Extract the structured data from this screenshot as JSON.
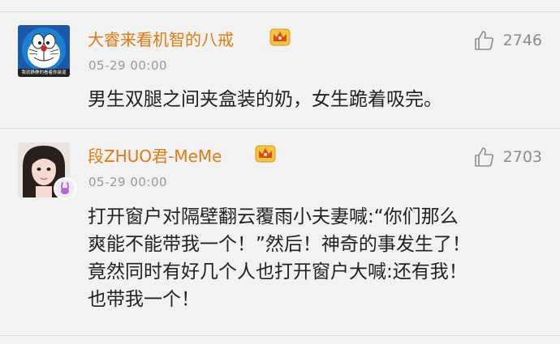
{
  "comments": [
    {
      "username": "大睿来看机智的八戒",
      "timestamp": "05-29 00:00",
      "likes": "2746",
      "text": "男生双腿之间夹盒装的奶，女生跪着吸完。",
      "avatar_caption": "我就静静的看着你装逼"
    },
    {
      "username": "段ZHUO君-MeMe",
      "timestamp": "05-29 00:00",
      "likes": "2703",
      "text": "打开窗户对隔壁翻云覆雨小夫妻喊:“你们那么爽能不能带我一个！”然后！神奇的事发生了！竟然同时有好几个人也打开窗户大喊:还有我！也带我一个！"
    }
  ],
  "colors": {
    "username": "#e07a12",
    "timestamp": "#9a9a9a",
    "text": "#222222",
    "likes": "#8c8c8c",
    "background": "#f2f2f2"
  },
  "icons": [
    "like-thumb-icon",
    "vip-crown-icon",
    "rabbit-badge-icon"
  ]
}
